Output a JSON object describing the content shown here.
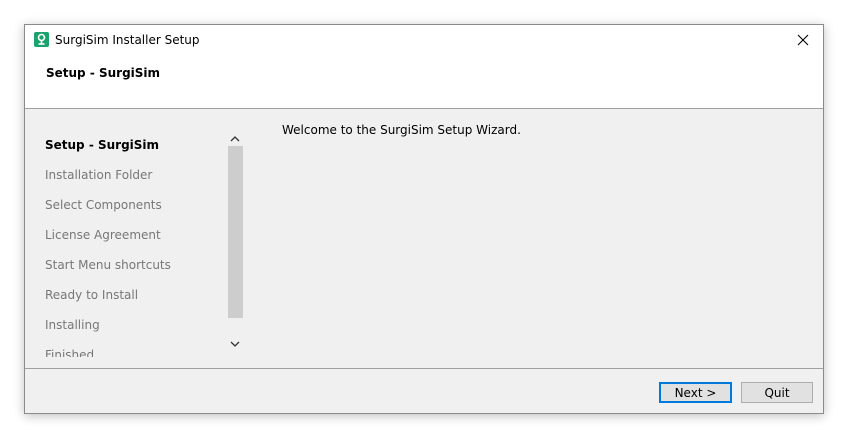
{
  "window": {
    "title": "SurgiSim Installer Setup",
    "header_title": "Setup - SurgiSim"
  },
  "steps": [
    {
      "label": "Setup - SurgiSim",
      "current": true
    },
    {
      "label": "Installation Folder",
      "current": false
    },
    {
      "label": "Select Components",
      "current": false
    },
    {
      "label": "License Agreement",
      "current": false
    },
    {
      "label": "Start Menu shortcuts",
      "current": false
    },
    {
      "label": "Ready to Install",
      "current": false
    },
    {
      "label": "Installing",
      "current": false
    },
    {
      "label": "Finished",
      "current": false
    }
  ],
  "main": {
    "welcome_text": "Welcome to the SurgiSim Setup Wizard."
  },
  "buttons": {
    "next_label": "Next >",
    "quit_label": "Quit"
  },
  "colors": {
    "accent": "#0078d7",
    "app_icon": "#1aa36d"
  },
  "icons": {
    "app": "surgisim-app-icon",
    "close": "close-icon",
    "scroll_up": "chevron-up-icon",
    "scroll_down": "chevron-down-icon"
  }
}
